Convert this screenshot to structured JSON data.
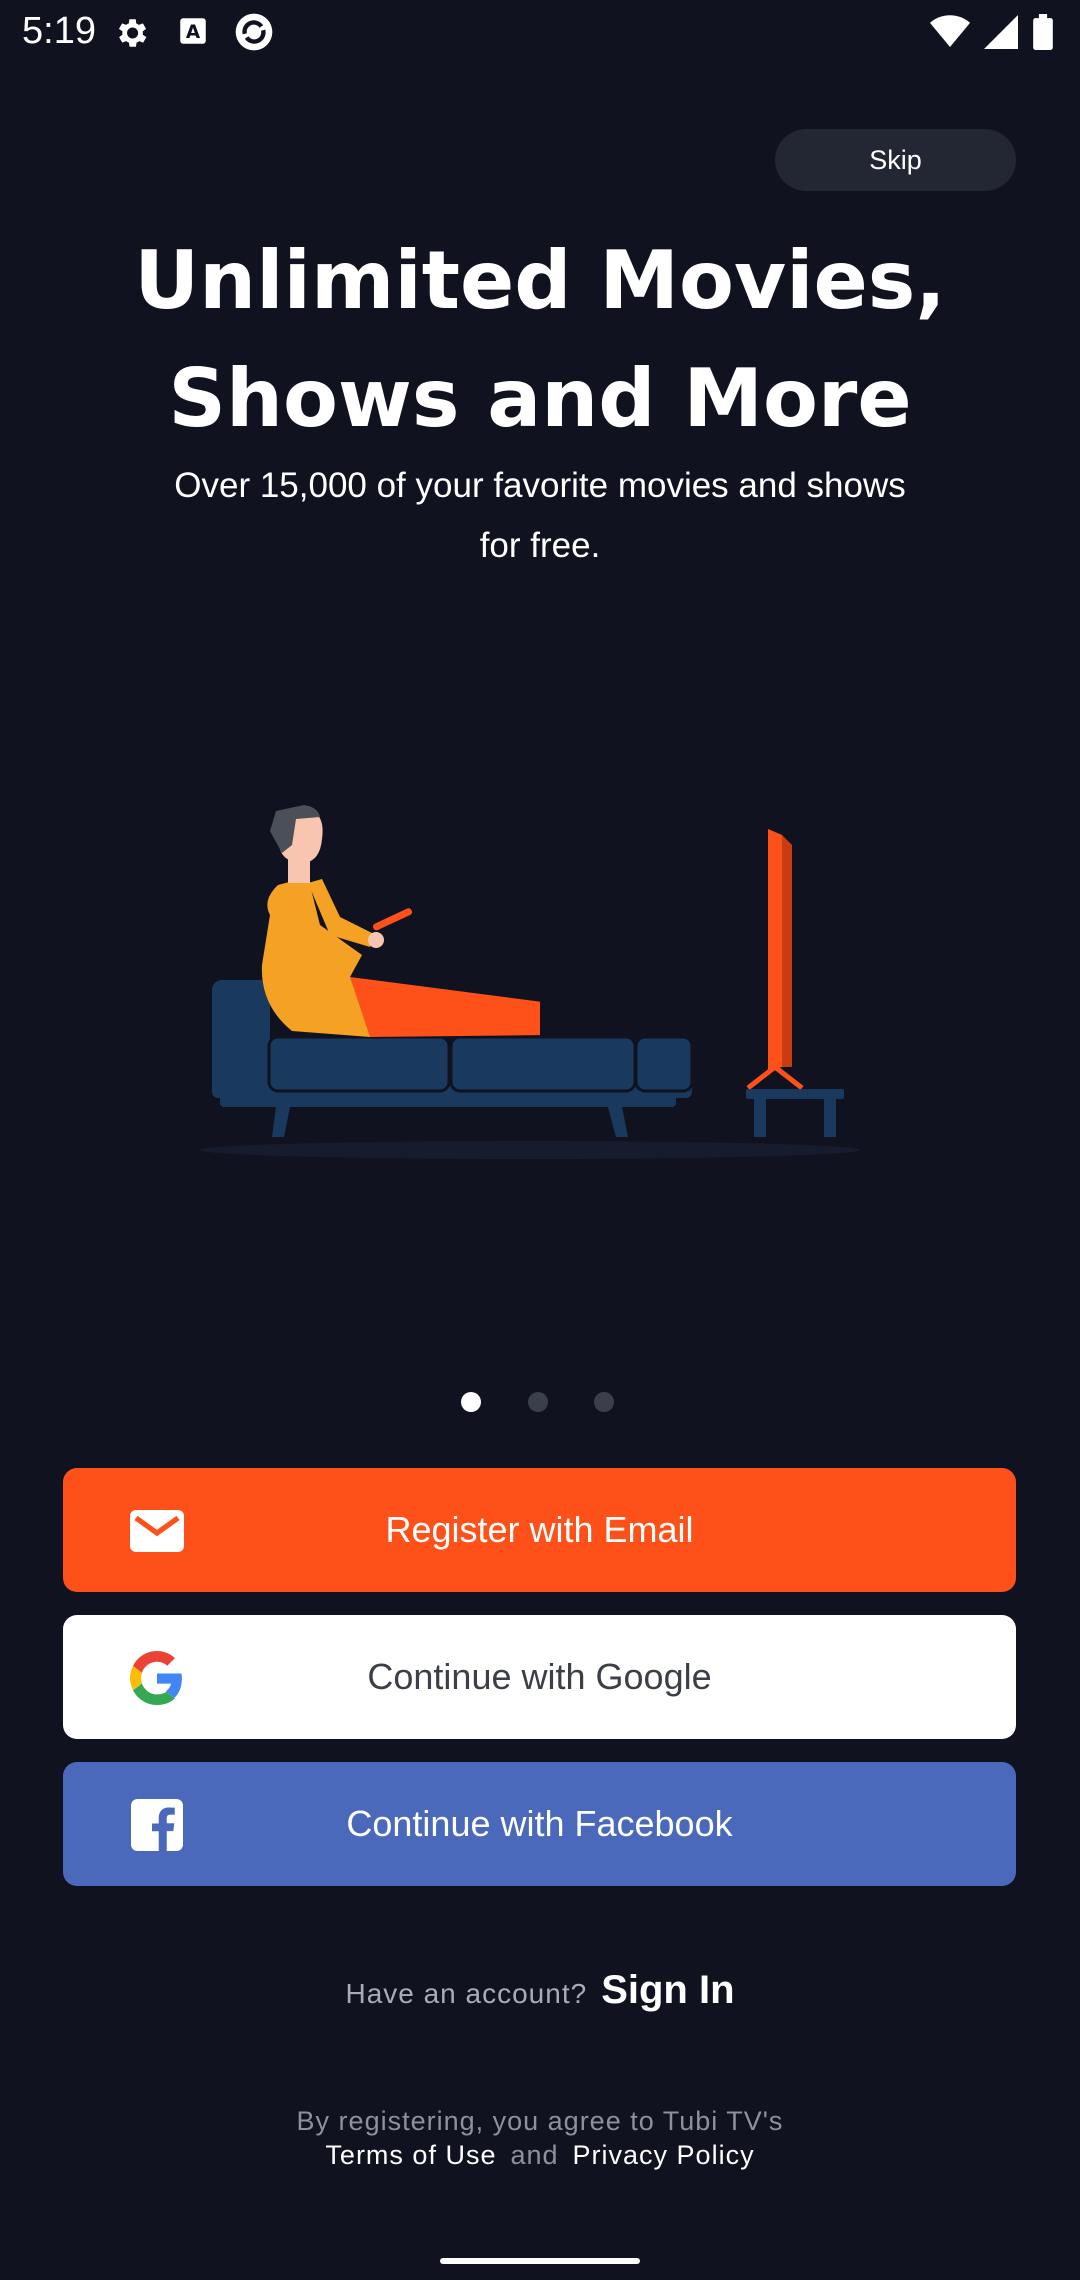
{
  "status_bar": {
    "time": "5:19",
    "left_icons": [
      "gear-icon",
      "font-a-icon",
      "sync-app-icon"
    ],
    "right_icons": [
      "wifi-icon",
      "signal-icon",
      "battery-icon"
    ]
  },
  "onboarding": {
    "skip_label": "Skip",
    "title_line1": "Unlimited Movies,",
    "title_line2": "Shows and More",
    "subtitle_line1": "Over 15,000 of your favorite movies and shows",
    "subtitle_line2": "for free.",
    "illustration": "person-on-couch-watching-tv",
    "pager": {
      "total": 3,
      "active_index": 0
    }
  },
  "buttons": {
    "email_label": "Register with Email",
    "google_label": "Continue with Google",
    "facebook_label": "Continue with Facebook"
  },
  "signin": {
    "prompt": "Have an account?",
    "link": "Sign In"
  },
  "legal": {
    "line1": "By registering, you agree to Tubi TV's",
    "terms": "Terms of Use",
    "and": "and",
    "privacy": "Privacy Policy"
  },
  "colors": {
    "background": "#10131f",
    "email_button": "#fe5019",
    "google_button": "#ffffff",
    "facebook_button": "#4a69bb",
    "skip_button": "#232733"
  }
}
